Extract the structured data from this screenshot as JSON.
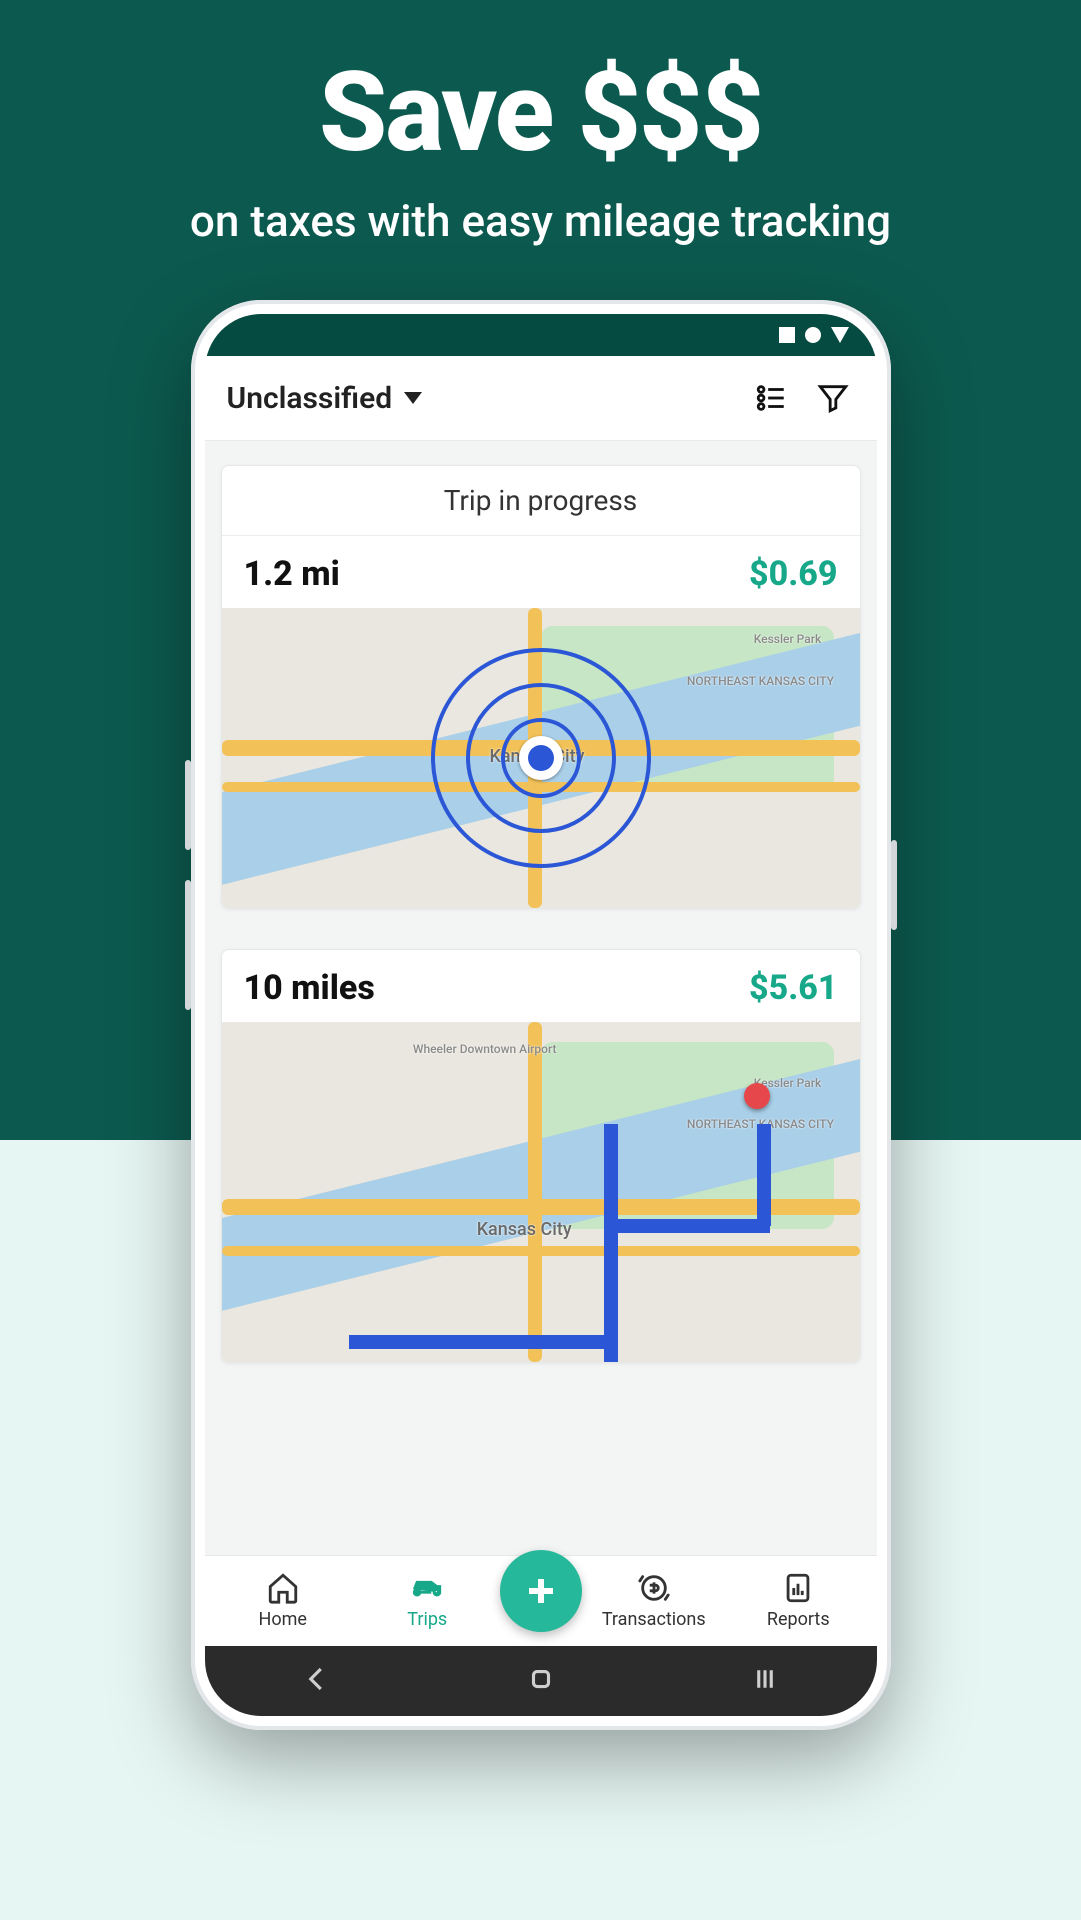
{
  "promo": {
    "headline": "Save $$$",
    "subline": "on taxes with easy mileage tracking"
  },
  "filter": {
    "selected": "Unclassified"
  },
  "trips": [
    {
      "title": "Trip in progress",
      "distance": "1.2 mi",
      "amount": "$0.69",
      "city_label": "Kansas City",
      "park_label": "Kessler Park",
      "ne_label": "NORTHEAST KANSAS CITY"
    },
    {
      "distance": "10 miles",
      "amount": "$5.61",
      "city_label": "Kansas City",
      "park_label": "Kessler Park",
      "ne_label": "NORTHEAST KANSAS CITY",
      "airport_label": "Wheeler Downtown Airport"
    }
  ],
  "nav": {
    "home": "Home",
    "trips": "Trips",
    "transactions": "Transactions",
    "reports": "Reports"
  },
  "colors": {
    "brand_dark": "#0c5a4f",
    "accent": "#17a789"
  }
}
